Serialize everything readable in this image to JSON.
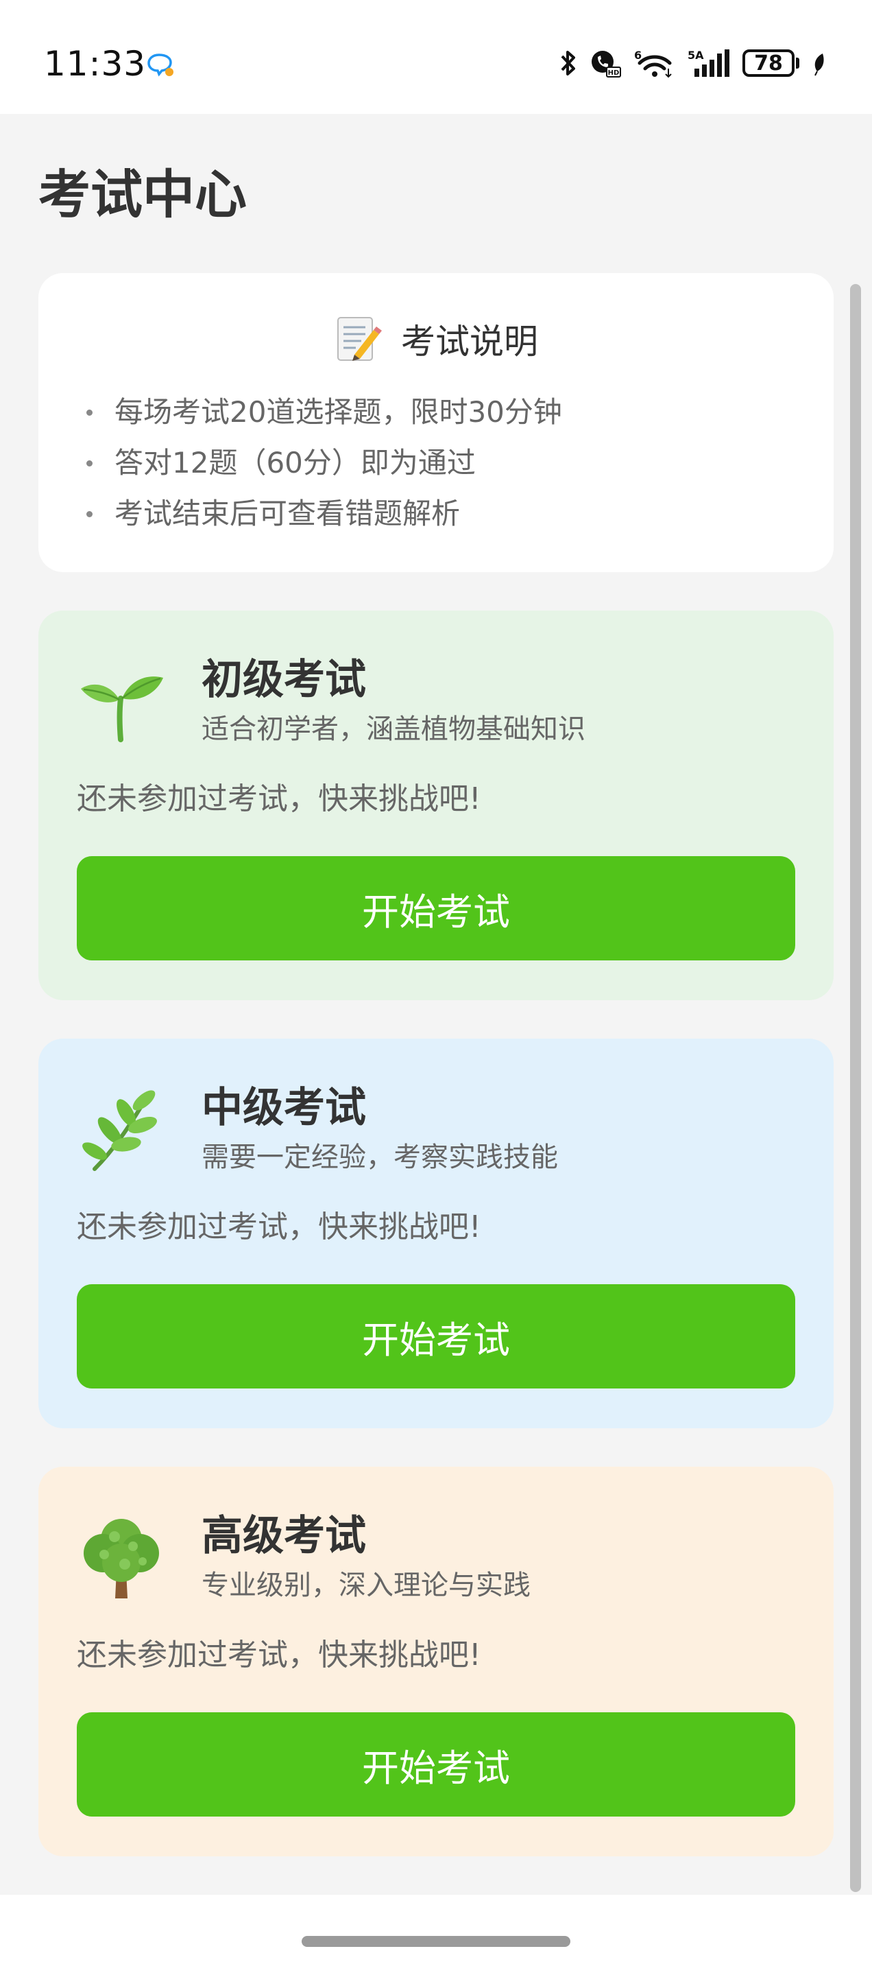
{
  "status_bar": {
    "time": "11:33",
    "battery": "78",
    "network_label": "5A",
    "wifi_label": "6"
  },
  "page": {
    "title": "考试中心"
  },
  "info_card": {
    "icon": "memo-icon",
    "title": "考试说明",
    "items": [
      "每场考试20道选择题，限时30分钟",
      "答对12题（60分）即为通过",
      "考试结束后可查看错题解析"
    ]
  },
  "levels": [
    {
      "icon": "seedling-icon",
      "title": "初级考试",
      "desc": "适合初学者，涵盖植物基础知识",
      "status": "还未参加过考试，快来挑战吧!",
      "button": "开始考试",
      "bg_color": "#e6f4e6"
    },
    {
      "icon": "herb-icon",
      "title": "中级考试",
      "desc": "需要一定经验，考察实践技能",
      "status": "还未参加过考试，快来挑战吧!",
      "button": "开始考试",
      "bg_color": "#e1f1fc"
    },
    {
      "icon": "tree-icon",
      "title": "高级考试",
      "desc": "专业级别，深入理论与实践",
      "status": "还未参加过考试，快来挑战吧!",
      "button": "开始考试",
      "bg_color": "#fdf0e0"
    }
  ],
  "colors": {
    "accent_button": "#52c41a",
    "page_background": "#f4f4f4"
  }
}
